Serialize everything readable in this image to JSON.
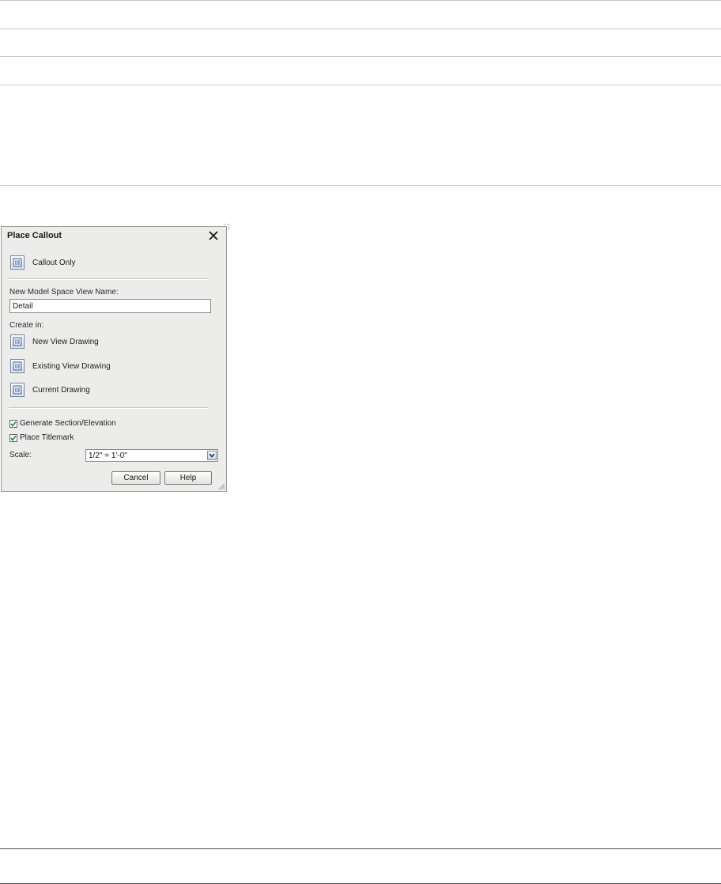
{
  "dialog": {
    "title": "Place Callout",
    "callout_only": "Callout Only",
    "view_name_label": "New Model Space View Name:",
    "view_name_value": "Detail",
    "create_in_label": "Create in:",
    "new_view_drawing": "New View Drawing",
    "existing_view_drawing": "Existing View Drawing",
    "current_drawing": "Current Drawing",
    "generate_section": "Generate Section/Elevation",
    "generate_section_checked": true,
    "place_titlemark": "Place Titlemark",
    "place_titlemark_checked": true,
    "scale_label": "Scale:",
    "scale_value": "1/2\" = 1'-0\"",
    "cancel": "Cancel",
    "help": "Help"
  },
  "icons": {
    "close": "close-icon",
    "command": "callout-tool-icon",
    "check": "checkmark-icon",
    "dropdown": "chevron-down-icon",
    "grip": "resize-grip-icon"
  },
  "colors": {
    "dialog_bg": "#ececea",
    "icon_border": "#6f85a8",
    "check_green": "#2d7d2d"
  }
}
